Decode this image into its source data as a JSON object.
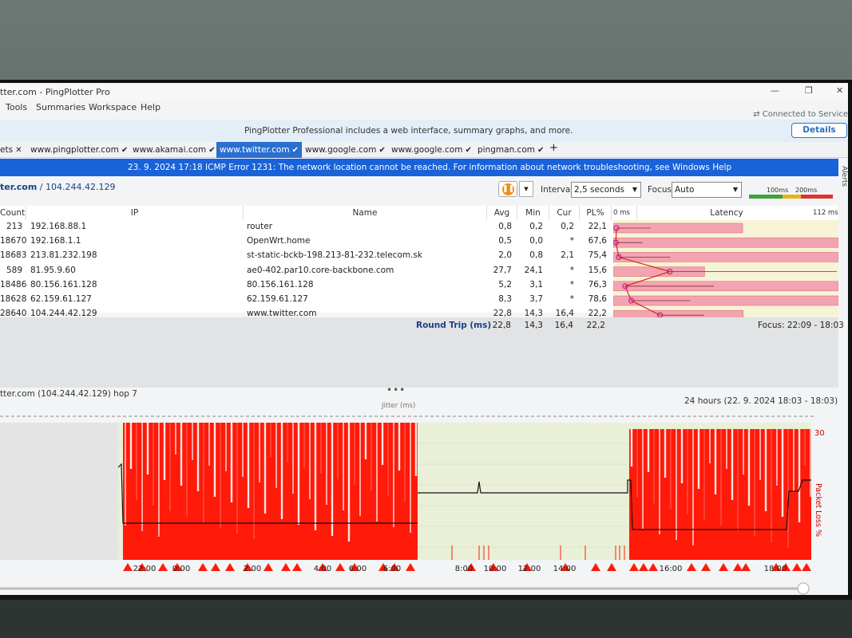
{
  "window": {
    "title": "tter.com - PingPlotter Pro",
    "minimize": "—",
    "restore": "❐",
    "close": "✕",
    "connected": "⇄ Connected to Service"
  },
  "menu": [
    "Tools",
    "Summaries",
    "Workspace",
    "Help"
  ],
  "promo": {
    "message": "PingPlotter Professional includes a web interface, summary graphs, and more.",
    "details": "Details"
  },
  "tabs": [
    {
      "label": "ets",
      "mark": "✕"
    },
    {
      "label": "www.pingplotter.com",
      "mark": "✔"
    },
    {
      "label": "www.akamai.com",
      "mark": "✔"
    },
    {
      "label": "www.twitter.com",
      "mark": "✔",
      "active": true
    },
    {
      "label": "www.google.com",
      "mark": "✔"
    },
    {
      "label": "www.google.com",
      "mark": "✔"
    },
    {
      "label": "pingman.com",
      "mark": "✔"
    },
    {
      "label": "+",
      "mark": ""
    }
  ],
  "error": "23. 9. 2024 17:18 ICMP Error 1231: The network location cannot be reached. For information about network troubleshooting, see Windows Help",
  "alerts_label": "Alerts",
  "target": {
    "host": "ter.com",
    "ip": "/ 104.244.42.129"
  },
  "controls": {
    "interval_label": "Interval",
    "interval_value": "2,5 seconds",
    "focus_label": "Focus",
    "focus_value": "Auto",
    "legend_100": "100ms",
    "legend_200": "200ms"
  },
  "columns": {
    "count": "Count",
    "ip": "IP",
    "name": "Name",
    "avg": "Avg",
    "min": "Min",
    "cur": "Cur",
    "pl": "PL%",
    "zero": "0 ms",
    "latency": "Latency",
    "max": "112 ms"
  },
  "hops": [
    {
      "count": "213",
      "ip": "192.168.88.1",
      "name": "router",
      "avg": "0,8",
      "min": "0,2",
      "cur": "0,2",
      "pl": "22,1",
      "pl_value": 22.1,
      "avg_value": 0.8,
      "max_value": 18
    },
    {
      "count": "18670",
      "ip": "192.168.1.1",
      "name": "OpenWrt.home",
      "avg": "0,5",
      "min": "0,0",
      "cur": "*",
      "pl": "67,6",
      "pl_value": 67.6,
      "avg_value": 0.5,
      "max_value": 14
    },
    {
      "count": "18683",
      "ip": "213.81.232.198",
      "name": "st-static-bckb-198.213-81-232.telecom.sk",
      "avg": "2,0",
      "min": "0,8",
      "cur": "2,1",
      "pl": "75,4",
      "pl_value": 75.4,
      "avg_value": 2.0,
      "max_value": 28
    },
    {
      "count": "589",
      "ip": "81.95.9.60",
      "name": "ae0-402.par10.core-backbone.com",
      "avg": "27,7",
      "min": "24,1",
      "cur": "*",
      "pl": "15,6",
      "pl_value": 15.6,
      "avg_value": 27.7,
      "max_value": 112
    },
    {
      "count": "18486",
      "ip": "80.156.161.128",
      "name": "80.156.161.128",
      "avg": "5,2",
      "min": "3,1",
      "cur": "*",
      "pl": "76,3",
      "pl_value": 76.3,
      "avg_value": 5.2,
      "max_value": 50
    },
    {
      "count": "18628",
      "ip": "62.159.61.127",
      "name": "62.159.61.127",
      "avg": "8,3",
      "min": "3,7",
      "cur": "*",
      "pl": "78,6",
      "pl_value": 78.6,
      "avg_value": 8.3,
      "max_value": 38
    },
    {
      "count": "28640",
      "ip": "104.244.42.129",
      "name": "www.twitter.com",
      "avg": "22,8",
      "min": "14,3",
      "cur": "16,4",
      "pl": "22,2",
      "pl_value": 22.2,
      "avg_value": 22.8,
      "max_value": 45
    }
  ],
  "total_count": "28640",
  "roundtrip": {
    "label": "Round Trip (ms)",
    "avg": "22,8",
    "min": "14,3",
    "cur": "16,4",
    "pl": "22,2",
    "focus": "Focus: 22:09 - 18:03"
  },
  "timeline": {
    "hop_label": "tter.com (104.244.42.129) hop 7",
    "range": "24 hours (22. 9. 2024 18:03 - 18:03)",
    "jitter": "Jitter (ms)",
    "right_axis_top": "30",
    "right_axis_label": "Packet Loss %",
    "ticks": [
      "22:00",
      "0:00",
      "2:00",
      "4:00",
      "6:00",
      "8:00",
      "10:00",
      "12:00",
      "14:00",
      "16:00",
      "18:00"
    ],
    "colors": {
      "loss": "#ff1a0a",
      "bg": "#eaf0d8",
      "gray": "#e4e4e4",
      "line": "#111111"
    }
  },
  "chart_data": {
    "type": "bar",
    "title": "",
    "categories": [
      "router",
      "OpenWrt.home",
      "st-static-bckb-198.213-81-232.telecom.sk",
      "ae0-402.par10.core-backbone.com",
      "80.156.161.128",
      "62.159.61.127",
      "www.twitter.com"
    ],
    "series": [
      {
        "name": "PL%",
        "values": [
          22.1,
          67.6,
          75.4,
          15.6,
          76.3,
          78.6,
          22.2
        ]
      }
    ],
    "xlim": [
      0,
      112
    ],
    "xlabel": "Latency"
  }
}
